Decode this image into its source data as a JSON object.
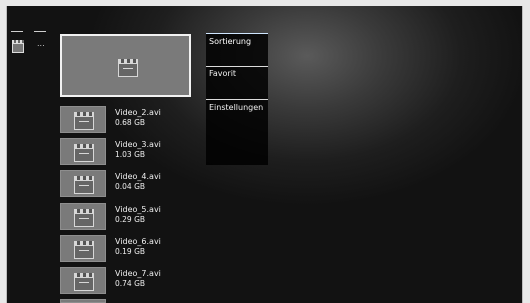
{
  "sidebar": {
    "mini_icons": [
      "clapperboard-icon",
      "ellipsis-icon"
    ],
    "mini_text": "..."
  },
  "selected_item": {
    "icon": "clapperboard-icon"
  },
  "videos": [
    {
      "name": "Video_2.avi",
      "size": "0.68 GB",
      "icon": "clapperboard-icon"
    },
    {
      "name": "Video_3.avi",
      "size": "1.03 GB",
      "icon": "clapperboard-icon"
    },
    {
      "name": "Video_4.avi",
      "size": "0.04 GB",
      "icon": "clapperboard-icon"
    },
    {
      "name": "Video_5.avi",
      "size": "0.29 GB",
      "icon": "clapperboard-icon"
    },
    {
      "name": "Video_6.avi",
      "size": "0.19 GB",
      "icon": "clapperboard-icon"
    },
    {
      "name": "Video_7.avi",
      "size": "0.74 GB",
      "icon": "clapperboard-icon"
    }
  ],
  "menu": {
    "items": [
      {
        "label": "Sortierung"
      },
      {
        "label": "Favorit"
      },
      {
        "label": "Einstellungen"
      }
    ]
  },
  "colors": {
    "background_dark": "#121212",
    "thumb_gray": "#7a7a7a",
    "selected_border": "#f2f2f2",
    "menu_background": "#000000",
    "text": "#efefef"
  }
}
